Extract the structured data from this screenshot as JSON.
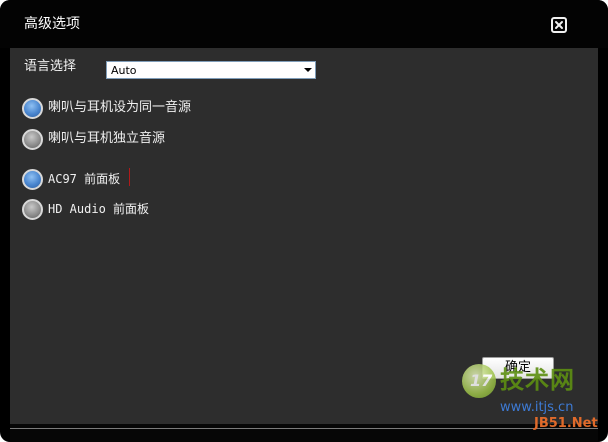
{
  "dialog": {
    "title": "高级选项",
    "close_icon": "close-icon"
  },
  "language": {
    "label": "语言选择",
    "selected": "Auto"
  },
  "speaker_options": [
    {
      "label": "喇叭与耳机设为同一音源",
      "selected": true
    },
    {
      "label": "喇叭与耳机独立音源",
      "selected": false
    }
  ],
  "panel_options": [
    {
      "label": "AC97 前面板",
      "selected": true
    },
    {
      "label": "HD Audio 前面板",
      "selected": false
    }
  ],
  "buttons": {
    "ok_label": "确定"
  },
  "watermark": {
    "logo_text": "17",
    "main": "技术网",
    "url": "www.itjs.cn",
    "small": "JB51.Net"
  },
  "colors": {
    "background": "#2d2d2d",
    "titlebar": "#030303",
    "radio_selected": "#4a86cf",
    "radio_unselected": "#8a8a8a"
  }
}
